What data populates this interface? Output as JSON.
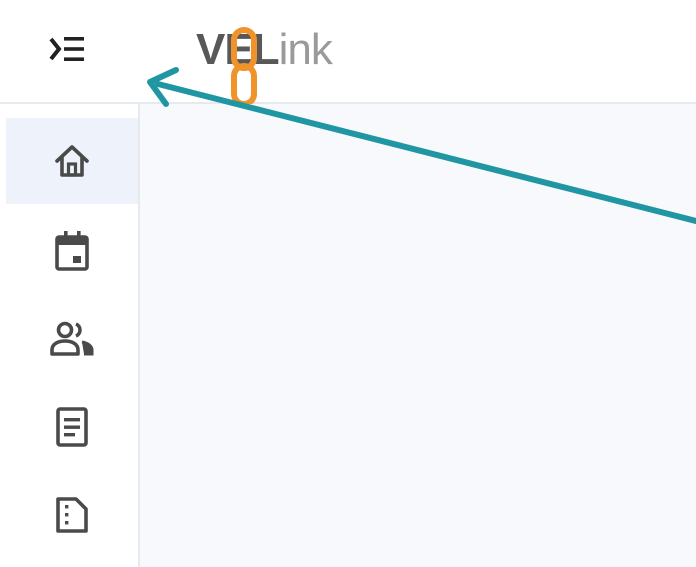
{
  "header": {
    "menu_toggle_icon": "menu-open-icon",
    "logo": {
      "part_v": "V",
      "part_e": "E",
      "part_l": "L",
      "part_rest": "ink",
      "accent_color": "#f0932b"
    }
  },
  "sidebar": {
    "items": [
      {
        "icon": "home-icon",
        "active": true
      },
      {
        "icon": "calendar-icon",
        "active": false
      },
      {
        "icon": "users-icon",
        "active": false
      },
      {
        "icon": "document-icon",
        "active": false
      },
      {
        "icon": "file-icon",
        "active": false
      }
    ]
  },
  "annotation": {
    "arrow_color": "#2196a3"
  }
}
